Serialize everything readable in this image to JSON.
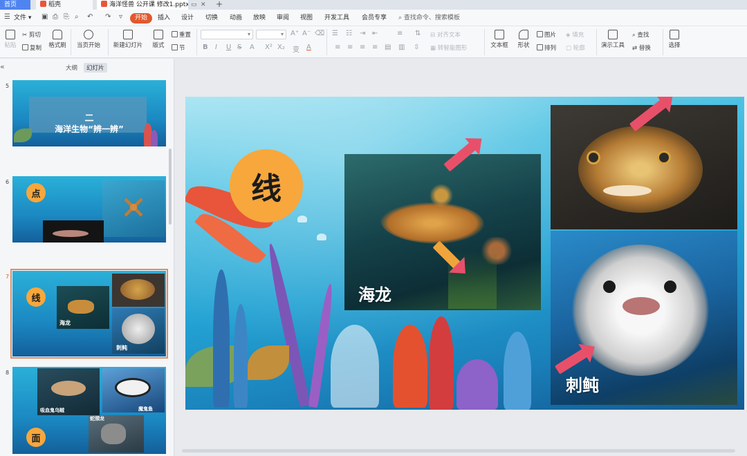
{
  "tabs": {
    "home": "首页",
    "docer": "稻壳",
    "doc": "海洋怪兽 公开课 修改1.pptx",
    "new_tab": "+"
  },
  "menubar": {
    "file": "文件",
    "items": [
      "开始",
      "插入",
      "设计",
      "切换",
      "动画",
      "放映",
      "审阅",
      "视图",
      "开发工具",
      "会员专享"
    ],
    "search": "查找命令、搜索模板"
  },
  "ribbon": {
    "paste": "粘贴",
    "cut": "剪切",
    "copy": "复制",
    "format_painter": "格式刷",
    "slideshow_from_current": "当页开始",
    "new_slide": "新建幻灯片",
    "layout": "版式",
    "reset": "重置",
    "section": "节",
    "align_text": "对齐文本",
    "convert_smartart": "转智能图形",
    "textbox": "文本框",
    "shape": "形状",
    "picture": "图片",
    "arrange": "排列",
    "fill": "填充",
    "outline": "轮廓",
    "presentation_tools": "演示工具",
    "find": "查找",
    "replace": "替换",
    "select": "选择",
    "format_buttons": [
      "B",
      "I",
      "U",
      "S",
      "A",
      "X²",
      "X₂",
      "A"
    ]
  },
  "left_pane": {
    "tab_outline": "大纲",
    "tab_slides": "幻灯片",
    "collapse": "«",
    "slides": [
      {
        "number": "5",
        "title_line1": "二",
        "title_line2": "海洋生物“辨一辨”"
      },
      {
        "number": "6",
        "badge": "点"
      },
      {
        "number": "7",
        "badge": "线",
        "label1": "海龙",
        "label2": "刺鲀"
      },
      {
        "number": "8",
        "badge": "面",
        "label1": "吸血鬼乌贼",
        "label2": "魔鬼鱼",
        "label3": "蛇颈龙"
      }
    ]
  },
  "slide": {
    "badge": "线",
    "seadragon_label": "海龙",
    "porcupinefish_label": "刺鲀"
  },
  "colors": {
    "accent": "#e3582d",
    "badge": "#f7a73c",
    "arrow": "#e8506a",
    "tab_blue": "#4f84f0"
  }
}
